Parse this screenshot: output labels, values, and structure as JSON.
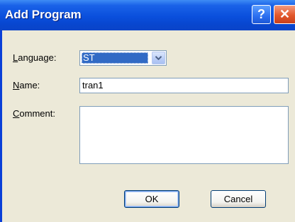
{
  "window": {
    "title": "Add Program",
    "help_symbol": "?",
    "close_symbol": "✕"
  },
  "form": {
    "language_label": "Language:",
    "language_value": "ST",
    "name_label": "Name:",
    "name_value": "tran1",
    "comment_label": "Comment:",
    "comment_value": ""
  },
  "buttons": {
    "ok": "OK",
    "cancel": "Cancel"
  },
  "icons": {
    "dropdown": "chevron-down-icon",
    "help": "help-icon",
    "close": "close-icon"
  }
}
